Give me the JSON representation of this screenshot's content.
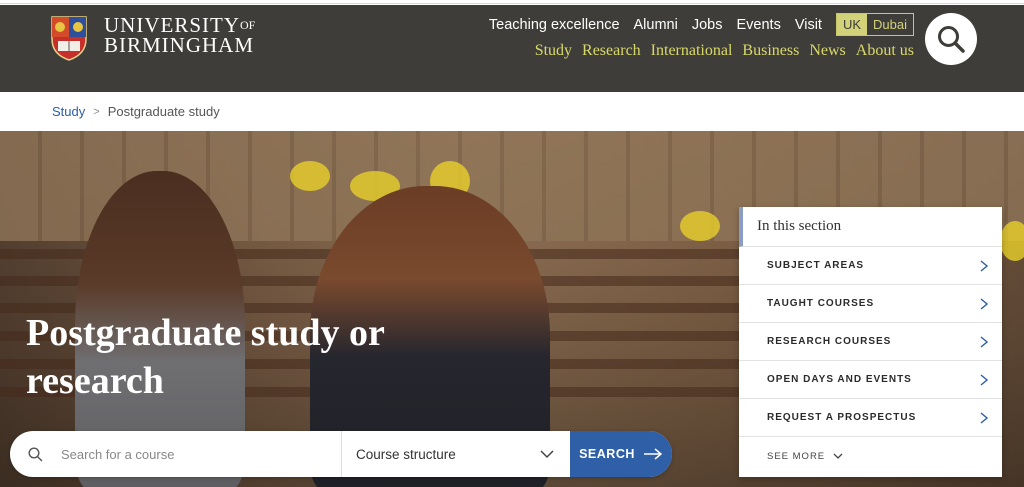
{
  "header": {
    "logo": {
      "line1": "UNIVERSITY",
      "of": "OF",
      "line2": "BIRMINGHAM"
    },
    "utility_links": [
      "Teaching excellence",
      "Alumni",
      "Jobs",
      "Events",
      "Visit"
    ],
    "campus": {
      "uk": "UK",
      "dubai": "Dubai"
    },
    "main_links": [
      "Study",
      "Research",
      "International",
      "Business",
      "News",
      "About us"
    ],
    "search_icon": "search-icon"
  },
  "breadcrumb": {
    "items": [
      "Study"
    ],
    "current": "Postgraduate study",
    "separator": ">"
  },
  "hero": {
    "title": "Postgraduate study or research"
  },
  "course_search": {
    "placeholder": "Search for a course",
    "select_value": "Course structure",
    "button_label": "SEARCH"
  },
  "section_panel": {
    "title": "In this section",
    "items": [
      "SUBJECT AREAS",
      "TAUGHT COURSES",
      "RESEARCH COURSES",
      "OPEN DAYS AND EVENTS",
      "REQUEST A PROSPECTUS"
    ],
    "see_more": "SEE MORE"
  },
  "colors": {
    "header_bg": "#3e3d39",
    "nav_gold": "#d9d96a",
    "accent_blue": "#2f5fa6",
    "link_blue": "#2a5fa4"
  }
}
